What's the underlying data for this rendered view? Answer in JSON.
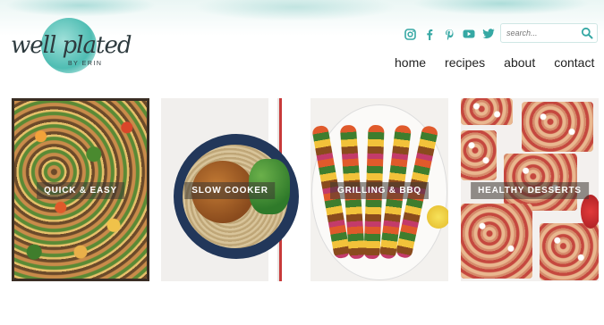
{
  "brand": {
    "logo_text": "well plated",
    "logo_sub": "BY ERIN",
    "accent": "#36a8a4"
  },
  "social": [
    {
      "name": "instagram-icon"
    },
    {
      "name": "facebook-icon"
    },
    {
      "name": "pinterest-icon"
    },
    {
      "name": "youtube-icon"
    },
    {
      "name": "twitter-icon"
    }
  ],
  "search": {
    "placeholder": "search...",
    "value": ""
  },
  "nav": {
    "items": [
      {
        "label": "home"
      },
      {
        "label": "recipes"
      },
      {
        "label": "about"
      },
      {
        "label": "contact"
      }
    ]
  },
  "categories": [
    {
      "label": "QUICK & EASY"
    },
    {
      "label": "SLOW COOKER"
    },
    {
      "label": "GRILLING & BBQ"
    },
    {
      "label": "HEALTHY DESSERTS"
    }
  ]
}
